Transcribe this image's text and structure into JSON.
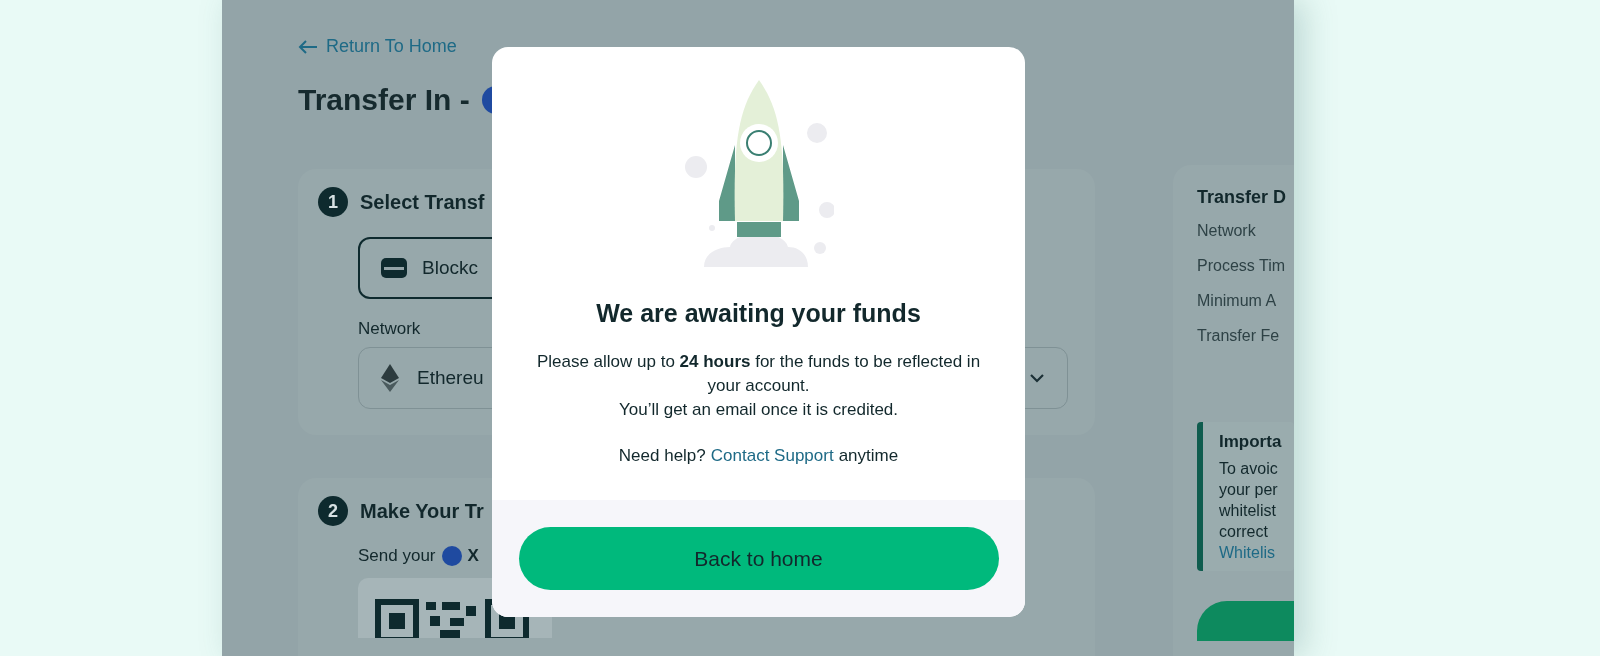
{
  "page": {
    "back_link": "Return To Home",
    "title": "Transfer In -"
  },
  "steps": [
    {
      "number": "1",
      "title": "Select Transf",
      "method": "Blockc",
      "network_label": "Network",
      "network_value": "Ethereu"
    },
    {
      "number": "2",
      "title": "Make Your Tr",
      "send_text": "Send your",
      "coin": "X"
    }
  ],
  "details": {
    "title": "Transfer D",
    "rows": [
      "Network",
      "Process Tim",
      "Minimum A",
      "Transfer Fe"
    ],
    "notice": {
      "title": "Importa",
      "lines": [
        "To avoic",
        "your per",
        "whitelist",
        "correct"
      ],
      "link": "Whitelis"
    }
  },
  "modal": {
    "title": "We are awaiting your funds",
    "message": "Please allow up to **24 hours** for the funds to be reflected in your account.",
    "message2": "You’ll get an email once it is credited.",
    "help_prefix": "Need help?",
    "help_link": "Contact Support",
    "help_suffix": "anytime",
    "button": "Back to home"
  }
}
